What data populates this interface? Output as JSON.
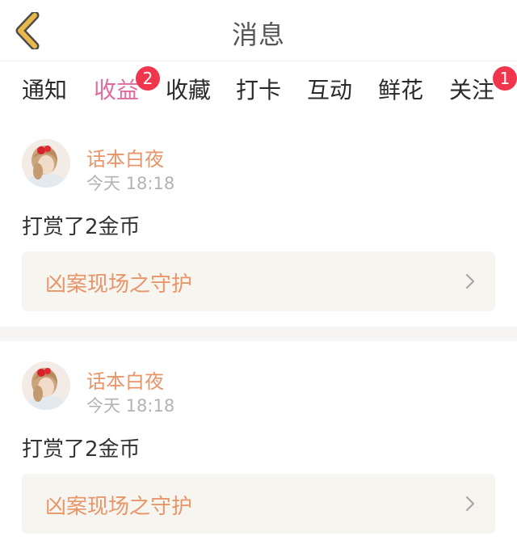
{
  "header": {
    "title": "消息"
  },
  "tabs": [
    {
      "label": "通知"
    },
    {
      "label": "收益",
      "badge": "2"
    },
    {
      "label": "收藏"
    },
    {
      "label": "打卡"
    },
    {
      "label": "互动"
    },
    {
      "label": "鲜花"
    },
    {
      "label": "关注",
      "badge": "1"
    }
  ],
  "active_tab": "收益",
  "messages": [
    {
      "username": "话本白夜",
      "time": "今天 18:18",
      "text": "打赏了2金币",
      "book_title": "凶案现场之守护"
    },
    {
      "username": "话本白夜",
      "time": "今天 18:18",
      "text": "打赏了2金币",
      "book_title": "凶案现场之守护"
    }
  ],
  "colors": {
    "accent": "#e06b9e",
    "badge": "#f0364d",
    "username": "#e8956a",
    "back_icon": "#e9b84a"
  }
}
